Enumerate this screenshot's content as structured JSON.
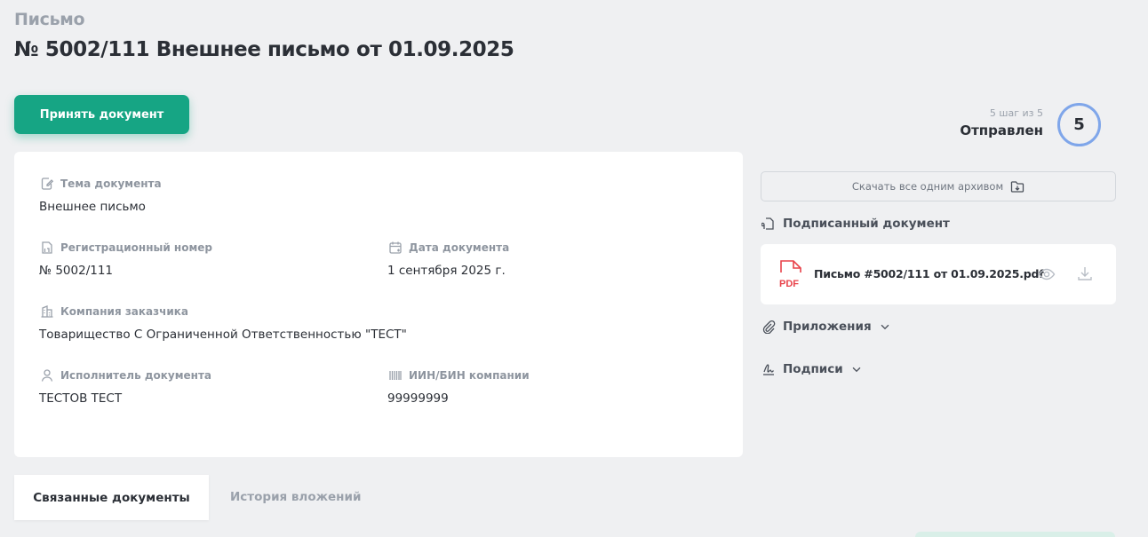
{
  "header": {
    "pre_title": "Письмо",
    "title": "№ 5002/111 Внешнее письмо от 01.09.2025"
  },
  "actions": {
    "accept_label": "Принять документ"
  },
  "status": {
    "step_caption": "5 шаг из 5",
    "status_label": "Отправлен",
    "step_number": "5",
    "progress": 1.0,
    "ring_color": "#7fa6ea"
  },
  "details": {
    "subject_label": "Тема документа",
    "subject_value": "Внешнее письмо",
    "reg_number_label": "Регистрационный номер",
    "reg_number_value": "№ 5002/111",
    "doc_date_label": "Дата документа",
    "doc_date_value": "1 сентября 2025 г.",
    "company_label": "Компания заказчика",
    "company_value": "Товарищество С Ограниченной Ответственностью \"ТЕСТ\"",
    "executor_label": "Исполнитель документа",
    "executor_value": "ТЕСТОВ ТЕСТ",
    "iin_label": "ИИН/БИН компании",
    "iin_value": "99999999"
  },
  "side": {
    "archive_label": "Скачать все одним архивом",
    "signed_doc_heading": "Подписанный документ",
    "file_badge": "PDF",
    "file_name": "Письмо #5002/111 от 01.09.2025.pdf",
    "attachments_label": "Приложения",
    "signatures_label": "Подписи"
  },
  "tabs": {
    "related_label": "Связанные документы",
    "history_label": "История вложений"
  },
  "colors": {
    "accent": "#16a584",
    "pdf_red": "#e8424a"
  }
}
